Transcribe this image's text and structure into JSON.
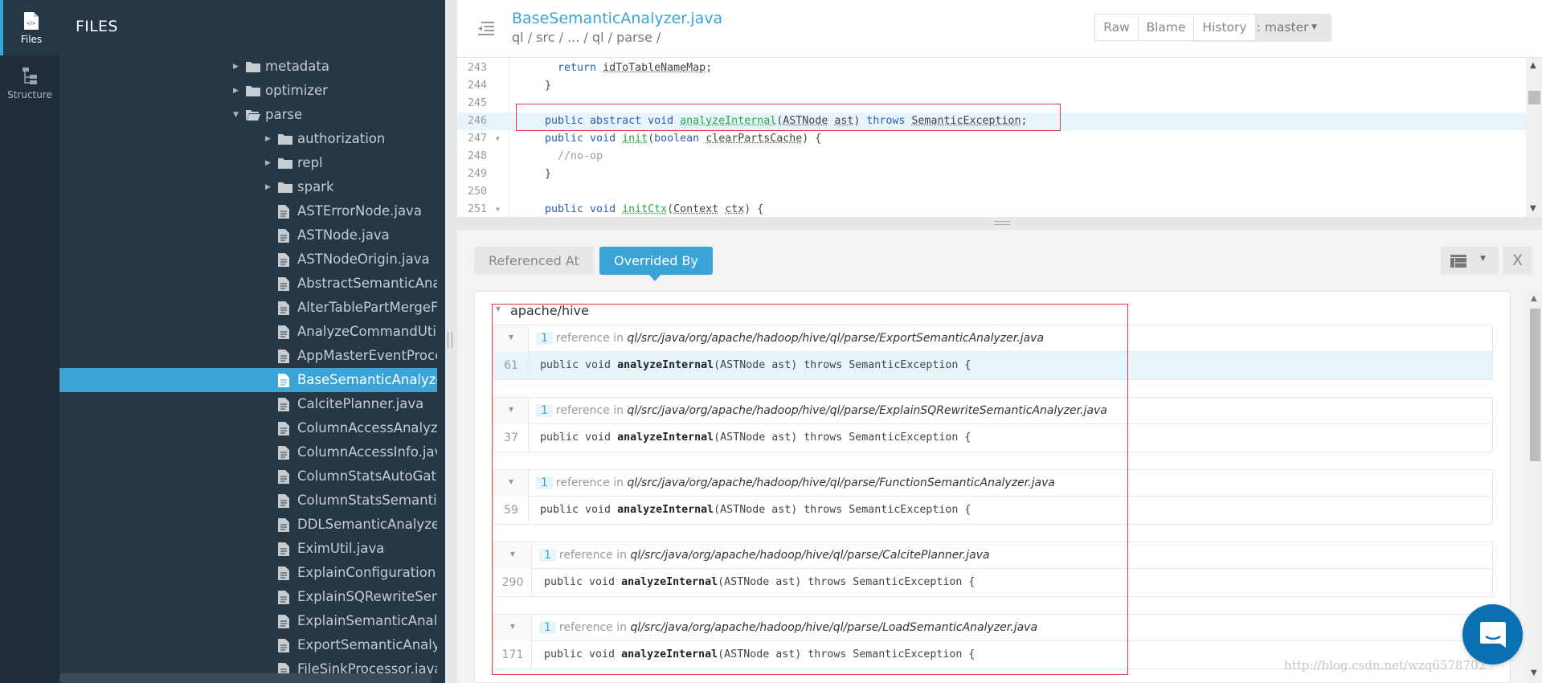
{
  "rail": {
    "items": [
      {
        "label": "Files",
        "icon": "code-file-icon",
        "active": true
      },
      {
        "label": "Structure",
        "icon": "structure-tree-icon",
        "active": false
      }
    ]
  },
  "files_panel": {
    "title": "FILES",
    "tree": [
      {
        "type": "folder",
        "name": "metadata",
        "depth": 0,
        "expanded": false
      },
      {
        "type": "folder",
        "name": "optimizer",
        "depth": 0,
        "expanded": false
      },
      {
        "type": "folder",
        "name": "parse",
        "depth": 0,
        "expanded": true
      },
      {
        "type": "folder",
        "name": "authorization",
        "depth": 1,
        "expanded": false
      },
      {
        "type": "folder",
        "name": "repl",
        "depth": 1,
        "expanded": false
      },
      {
        "type": "folder",
        "name": "spark",
        "depth": 1,
        "expanded": false
      },
      {
        "type": "file",
        "name": "ASTErrorNode.java",
        "depth": 1
      },
      {
        "type": "file",
        "name": "ASTNode.java",
        "depth": 1
      },
      {
        "type": "file",
        "name": "ASTNodeOrigin.java",
        "depth": 1
      },
      {
        "type": "file",
        "name": "AbstractSemanticAnal",
        "depth": 1
      },
      {
        "type": "file",
        "name": "AlterTablePartMergeF",
        "depth": 1
      },
      {
        "type": "file",
        "name": "AnalyzeCommandUtils",
        "depth": 1
      },
      {
        "type": "file",
        "name": "AppMasterEventProce",
        "depth": 1
      },
      {
        "type": "file",
        "name": "BaseSemanticAnalyze",
        "depth": 1,
        "selected": true
      },
      {
        "type": "file",
        "name": "CalcitePlanner.java",
        "depth": 1
      },
      {
        "type": "file",
        "name": "ColumnAccessAnalyze",
        "depth": 1
      },
      {
        "type": "file",
        "name": "ColumnAccessInfo.java",
        "depth": 1
      },
      {
        "type": "file",
        "name": "ColumnStatsAutoGath",
        "depth": 1
      },
      {
        "type": "file",
        "name": "ColumnStatsSemantic",
        "depth": 1
      },
      {
        "type": "file",
        "name": "DDLSemanticAnalyzer",
        "depth": 1
      },
      {
        "type": "file",
        "name": "EximUtil.java",
        "depth": 1
      },
      {
        "type": "file",
        "name": "ExplainConfiguration.j",
        "depth": 1
      },
      {
        "type": "file",
        "name": "ExplainSQRewriteSem",
        "depth": 1
      },
      {
        "type": "file",
        "name": "ExplainSemanticAnaly",
        "depth": 1
      },
      {
        "type": "file",
        "name": "ExportSemanticAnalyz",
        "depth": 1
      },
      {
        "type": "file",
        "name": "FileSinkProcessor.java",
        "depth": 1
      }
    ]
  },
  "header": {
    "file_title": "BaseSemanticAnalyzer.java",
    "breadcrumb": "ql / src / ... / ql / parse /",
    "branch_label": "Branch: master",
    "buttons": [
      "Raw",
      "Blame",
      "History"
    ]
  },
  "code": {
    "lines": [
      {
        "n": "243",
        "fold": false,
        "hl": false,
        "tokens": [
          [
            "",
            "    "
          ],
          [
            "kw",
            "return"
          ],
          [
            "",
            " "
          ],
          [
            "ty",
            "idToTableNameMap"
          ],
          [
            "",
            ";"
          ]
        ]
      },
      {
        "n": "244",
        "fold": false,
        "hl": false,
        "tokens": [
          [
            "",
            "  }"
          ]
        ]
      },
      {
        "n": "245",
        "fold": false,
        "hl": false,
        "tokens": []
      },
      {
        "n": "246",
        "fold": false,
        "hl": true,
        "tokens": [
          [
            "",
            "  "
          ],
          [
            "kw",
            "public abstract void"
          ],
          [
            "",
            " "
          ],
          [
            "fn",
            "analyzeInternal"
          ],
          [
            "",
            "("
          ],
          [
            "ty",
            "ASTNode"
          ],
          [
            "",
            " "
          ],
          [
            "ty",
            "ast"
          ],
          [
            "",
            ") "
          ],
          [
            "kw",
            "throws"
          ],
          [
            "",
            " "
          ],
          [
            "ty",
            "SemanticException"
          ],
          [
            "",
            ";"
          ]
        ]
      },
      {
        "n": "247",
        "fold": true,
        "hl": false,
        "tokens": [
          [
            "",
            "  "
          ],
          [
            "kw",
            "public void"
          ],
          [
            "",
            " "
          ],
          [
            "fn",
            "init"
          ],
          [
            "",
            "("
          ],
          [
            "kw",
            "boolean"
          ],
          [
            "",
            " "
          ],
          [
            "ty",
            "clearPartsCache"
          ],
          [
            "",
            ") {"
          ]
        ]
      },
      {
        "n": "248",
        "fold": false,
        "hl": false,
        "tokens": [
          [
            "",
            "    "
          ],
          [
            "cm",
            "//no-op"
          ]
        ]
      },
      {
        "n": "249",
        "fold": false,
        "hl": false,
        "tokens": [
          [
            "",
            "  }"
          ]
        ]
      },
      {
        "n": "250",
        "fold": false,
        "hl": false,
        "tokens": []
      },
      {
        "n": "251",
        "fold": true,
        "hl": false,
        "tokens": [
          [
            "",
            "  "
          ],
          [
            "kw",
            "public void"
          ],
          [
            "",
            " "
          ],
          [
            "fn",
            "initCtx"
          ],
          [
            "",
            "("
          ],
          [
            "ty",
            "Context"
          ],
          [
            "",
            " "
          ],
          [
            "ty",
            "ctx"
          ],
          [
            "",
            ") {"
          ]
        ]
      }
    ]
  },
  "panel": {
    "tabs": [
      {
        "label": "Referenced At",
        "active": false
      },
      {
        "label": "Overrided By",
        "active": true
      }
    ],
    "close_label": "X",
    "repo": "apache/hive",
    "references": [
      {
        "count": "1",
        "prefix": "reference in",
        "path": "ql/src/java/org/apache/hadoop/hive/ql/parse/ExportSemanticAnalyzer.java",
        "line": "61",
        "highlighted": true,
        "code_pre": "public void ",
        "code_bold": "analyzeInternal",
        "code_post": "(ASTNode ast) throws SemanticException {"
      },
      {
        "count": "1",
        "prefix": "reference in",
        "path": "ql/src/java/org/apache/hadoop/hive/ql/parse/ExplainSQRewriteSemanticAnalyzer.java",
        "line": "37",
        "highlighted": false,
        "code_pre": "public void ",
        "code_bold": "analyzeInternal",
        "code_post": "(ASTNode ast) throws SemanticException {"
      },
      {
        "count": "1",
        "prefix": "reference in",
        "path": "ql/src/java/org/apache/hadoop/hive/ql/parse/FunctionSemanticAnalyzer.java",
        "line": "59",
        "highlighted": false,
        "code_pre": "public void ",
        "code_bold": "analyzeInternal",
        "code_post": "(ASTNode ast) throws SemanticException {"
      },
      {
        "count": "1",
        "prefix": "reference in",
        "path": "ql/src/java/org/apache/hadoop/hive/ql/parse/CalcitePlanner.java",
        "line": "290",
        "highlighted": false,
        "code_pre": "public void ",
        "code_bold": "analyzeInternal",
        "code_post": "(ASTNode ast) throws SemanticException {"
      },
      {
        "count": "1",
        "prefix": "reference in",
        "path": "ql/src/java/org/apache/hadoop/hive/ql/parse/LoadSemanticAnalyzer.java",
        "line": "171",
        "highlighted": false,
        "code_pre": "public void ",
        "code_bold": "analyzeInternal",
        "code_post": "(ASTNode ast) throws SemanticException {"
      }
    ]
  },
  "watermark": "http://blog.csdn.net/wzq6578702",
  "colors": {
    "accent": "#3ba3d5",
    "sidebar": "#263846",
    "rail": "#1f2d38",
    "annotation": "#e23a3a",
    "chat": "#0b6fb3"
  }
}
